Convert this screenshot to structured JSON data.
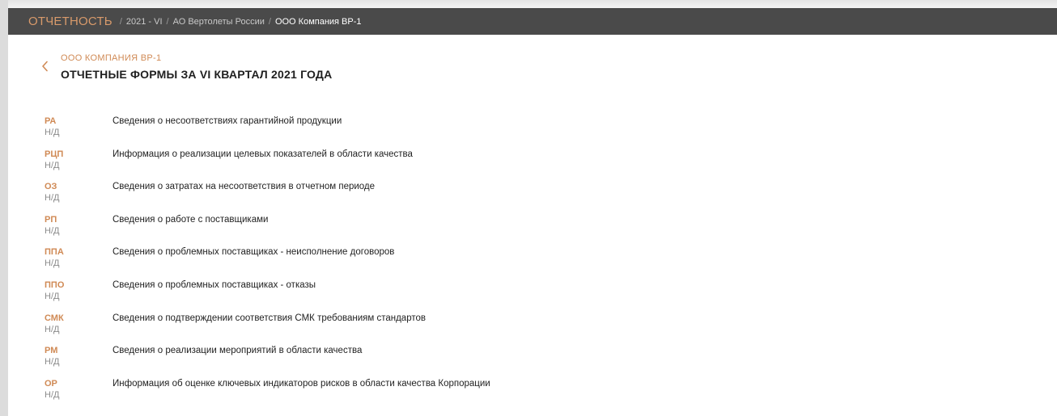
{
  "topbar": {
    "brand": "ОТЧЕТНОСТЬ",
    "separator": "/",
    "breadcrumbs": [
      {
        "label": "2021 - VI"
      },
      {
        "label": "АО Вертолеты России"
      },
      {
        "label": "ООО Компания ВР-1"
      }
    ]
  },
  "header": {
    "back_icon": "chevron-left-icon",
    "company": "ООО КОМПАНИЯ ВР-1",
    "title": "ОТЧЕТНЫЕ ФОРМЫ ЗА VI КВАРТАЛ 2021 ГОДА"
  },
  "forms": [
    {
      "code": "РА",
      "status": "Н/Д",
      "title": "Сведения о несоответствиях гарантийной продукции"
    },
    {
      "code": "РЦП",
      "status": "Н/Д",
      "title": "Информация о реализации целевых показателей в области качества"
    },
    {
      "code": "ОЗ",
      "status": "Н/Д",
      "title": "Сведения о затратах на несоответствия в отчетном периоде"
    },
    {
      "code": "РП",
      "status": "Н/Д",
      "title": "Сведения о работе с поставщиками"
    },
    {
      "code": "ППА",
      "status": "Н/Д",
      "title": "Сведения о проблемных поставщиках - неисполнение договоров"
    },
    {
      "code": "ППО",
      "status": "Н/Д",
      "title": "Сведения о проблемных поставщиках - отказы"
    },
    {
      "code": "СМК",
      "status": "Н/Д",
      "title": "Сведения о подтверждении соответствия СМК требованиям стандартов"
    },
    {
      "code": "РМ",
      "status": "Н/Д",
      "title": "Сведения о реализации мероприятий в области качества"
    },
    {
      "code": "ОР",
      "status": "Н/Д",
      "title": "Информация об оценке ключевых индикаторов рисков в области качества Корпорации"
    }
  ],
  "colors": {
    "topbar_bg": "#4a4a4a",
    "accent": "#d08a55",
    "status_gray": "#8a8a8a"
  }
}
